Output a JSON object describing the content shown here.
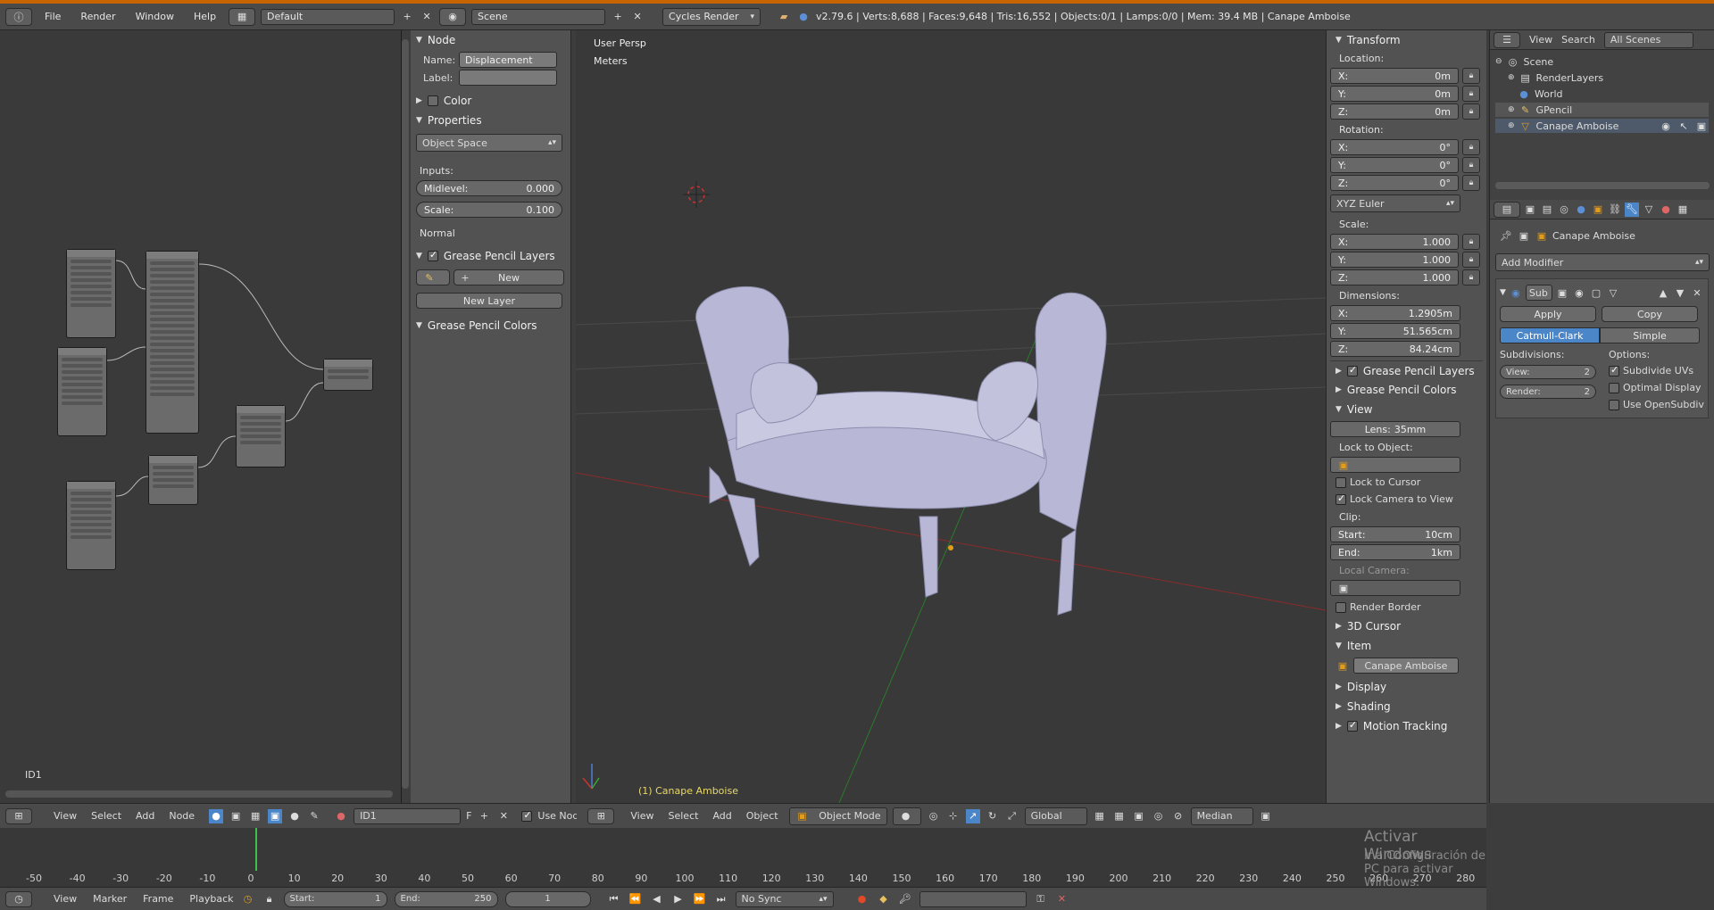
{
  "topbar": {
    "menus": [
      "File",
      "Render",
      "Window",
      "Help"
    ],
    "layout": "Default",
    "scene": "Scene",
    "engine": "Cycles Render",
    "stats": "v2.79.6 | Verts:8,688 | Faces:9,648 | Tris:16,552 | Objects:0/1 | Lamps:0/0 | Mem: 39.4 MB | Canape Amboise"
  },
  "node_sidebar": {
    "node_header": "Node",
    "name_label": "Name:",
    "name_value": "Displacement",
    "label_label": "Label:",
    "label_value": "",
    "color_header": "Color",
    "properties_header": "Properties",
    "space": "Object Space",
    "inputs_label": "Inputs:",
    "midlevel_label": "Midlevel:",
    "midlevel_value": "0.000",
    "scale_label": "Scale:",
    "scale_value": "0.100",
    "normal_label": "Normal",
    "gp_layers_header": "Grease Pencil Layers",
    "new_label": "New",
    "new_layer_label": "New Layer",
    "gp_colors_header": "Grease Pencil Colors"
  },
  "node_editor": {
    "id_label": "ID1"
  },
  "viewport": {
    "persp": "User Persp",
    "units": "Meters",
    "object_label": "(1) Canape Amboise"
  },
  "view_sidebar": {
    "transform_header": "Transform",
    "location_label": "Location:",
    "location": [
      {
        "axis": "X:",
        "value": "0m"
      },
      {
        "axis": "Y:",
        "value": "0m"
      },
      {
        "axis": "Z:",
        "value": "0m"
      }
    ],
    "rotation_label": "Rotation:",
    "rotation": [
      {
        "axis": "X:",
        "value": "0°"
      },
      {
        "axis": "Y:",
        "value": "0°"
      },
      {
        "axis": "Z:",
        "value": "0°"
      }
    ],
    "rotation_mode": "XYZ Euler",
    "scale_label": "Scale:",
    "scale": [
      {
        "axis": "X:",
        "value": "1.000"
      },
      {
        "axis": "Y:",
        "value": "1.000"
      },
      {
        "axis": "Z:",
        "value": "1.000"
      }
    ],
    "dimensions_label": "Dimensions:",
    "dimensions": [
      {
        "axis": "X:",
        "value": "1.2905m"
      },
      {
        "axis": "Y:",
        "value": "51.565cm"
      },
      {
        "axis": "Z:",
        "value": "84.24cm"
      }
    ],
    "gp_layers_header": "Grease Pencil Layers",
    "gp_colors_header": "Grease Pencil Colors",
    "view_header": "View",
    "lens_label": "Lens:",
    "lens_value": "35mm",
    "lock_object_label": "Lock to Object:",
    "lock_cursor_label": "Lock to Cursor",
    "lock_camera_label": "Lock Camera to View",
    "clip_label": "Clip:",
    "clip_start_label": "Start:",
    "clip_start_value": "10cm",
    "clip_end_label": "End:",
    "clip_end_value": "1km",
    "local_camera_label": "Local Camera:",
    "render_border_label": "Render Border",
    "cursor_header": "3D Cursor",
    "item_header": "Item",
    "item_name": "Canape Amboise",
    "display_header": "Display",
    "shading_header": "Shading",
    "motion_header": "Motion Tracking"
  },
  "outliner": {
    "menus": [
      "View",
      "Search"
    ],
    "filter": "All Scenes",
    "items": [
      {
        "label": "Scene",
        "depth": 0
      },
      {
        "label": "RenderLayers",
        "depth": 1
      },
      {
        "label": "World",
        "depth": 1
      },
      {
        "label": "GPencil",
        "depth": 1
      },
      {
        "label": "Canape Amboise",
        "depth": 1
      }
    ]
  },
  "properties": {
    "object_name": "Canape Amboise",
    "add_modifier": "Add Modifier",
    "modifier_name": "Sub",
    "apply_label": "Apply",
    "copy_label": "Copy",
    "catmull_label": "Catmull-Clark",
    "simple_label": "Simple",
    "subdivisions_label": "Subdivisions:",
    "options_label": "Options:",
    "view_label": "View:",
    "view_value": "2",
    "render_label": "Render:",
    "render_value": "2",
    "subdivide_uvs_label": "Subdivide UVs",
    "optimal_display_label": "Optimal Display",
    "opensubdiv_label": "Use OpenSubdiv"
  },
  "node_header_bar": {
    "menus": [
      "View",
      "Select",
      "Add",
      "Node"
    ],
    "datablock": "ID1",
    "fake_user": "F",
    "use_nodes": "Use Nodes"
  },
  "view3d_header_bar": {
    "menus": [
      "View",
      "Select",
      "Add",
      "Object"
    ],
    "mode": "Object Mode",
    "orientation": "Global",
    "pivot": "Median"
  },
  "timeline": {
    "ticks": [
      "-50",
      "-40",
      "-30",
      "-20",
      "-10",
      "0",
      "10",
      "20",
      "30",
      "40",
      "50",
      "60",
      "70",
      "80",
      "90",
      "100",
      "110",
      "120",
      "130",
      "140",
      "150",
      "160",
      "170",
      "180",
      "190",
      "200",
      "210",
      "220",
      "230",
      "240",
      "250",
      "260",
      "270",
      "280"
    ],
    "watermark_title": "Activar Windows",
    "watermark_sub": "Ir a Configuración de PC para activar Windows."
  },
  "timeline_header": {
    "menus": [
      "View",
      "Marker",
      "Frame",
      "Playback"
    ],
    "start_label": "Start:",
    "start_value": "1",
    "end_label": "End:",
    "end_value": "250",
    "current_frame": "1",
    "sync": "No Sync"
  }
}
